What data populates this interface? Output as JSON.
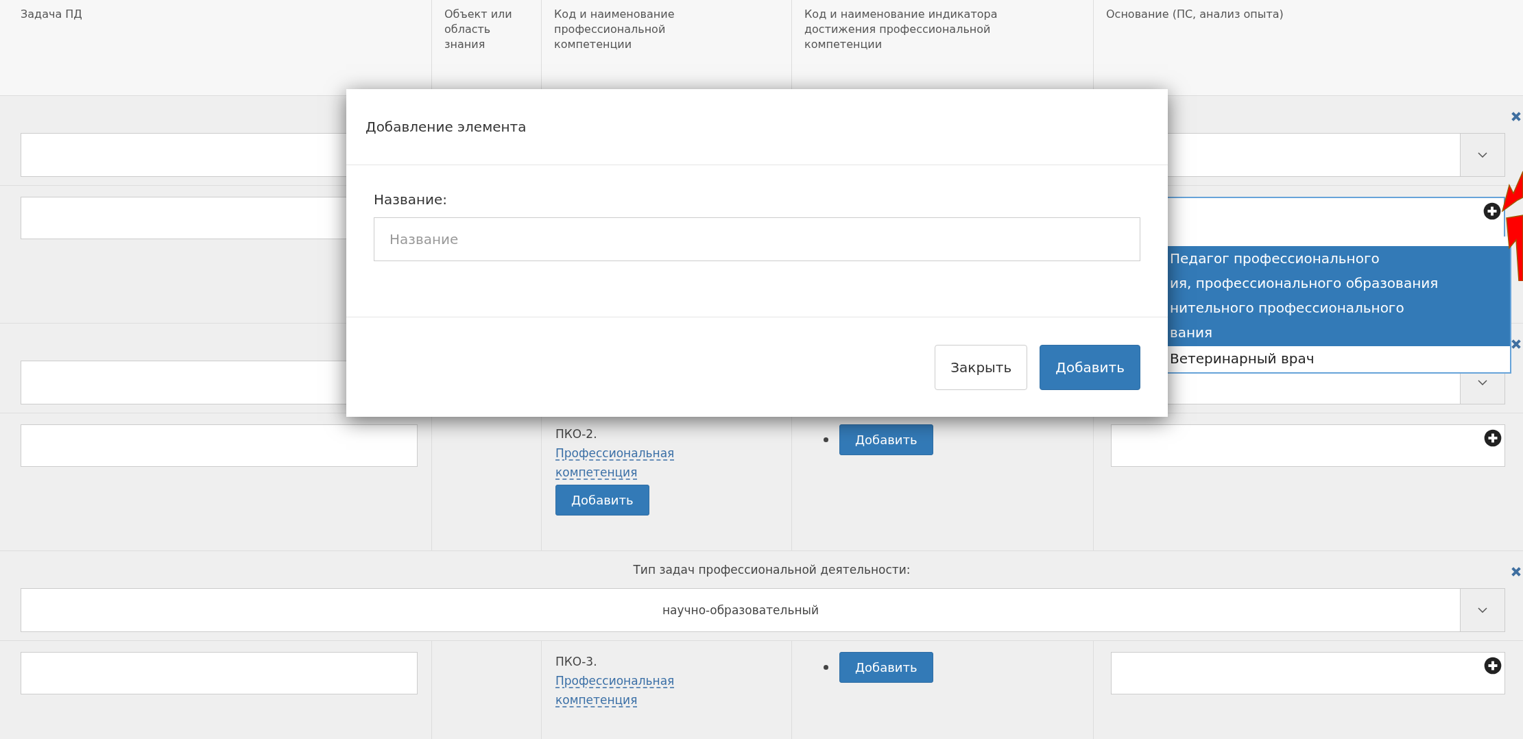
{
  "table": {
    "columns": [
      "Задача ПД",
      "Объект или область знания",
      "Код и наименование профессиональной компетенции",
      "Код и наименование индикатора достижения профессиональной компетенции",
      "Основание (ПС, анализ опыта)"
    ],
    "rows": [
      {
        "kind": "type"
      },
      {
        "kind": "task",
        "basis_focused": true
      },
      {
        "kind": "type"
      },
      {
        "kind": "task",
        "code": "ПКО-2.",
        "competence": "Профессиональная компетенция",
        "competence_button": "Добавить",
        "indicator_button": "Добавить",
        "basis_focused": false
      },
      {
        "kind": "type",
        "label": "Тип задач профессиональной деятельности:",
        "value": "научно-образовательный"
      },
      {
        "kind": "task",
        "code": "ПКО-3.",
        "competence": "Профессиональная компетенция",
        "indicator_button": "Добавить",
        "basis_focused": false
      }
    ]
  },
  "dropdown": {
    "options": [
      {
        "lines": [
          "Педагог профессионального",
          "ия, профессионального образования",
          "нительного профессионального",
          "вания"
        ],
        "selected": true
      },
      {
        "lines": [
          "Ветеринарный врач"
        ],
        "selected": false
      }
    ]
  },
  "modal": {
    "title": "Добавление элемента",
    "field_label": "Название:",
    "placeholder": "Название",
    "buttons": [
      {
        "label": "Закрыть",
        "kind": "default"
      },
      {
        "label": "Добавить",
        "kind": "primary"
      }
    ]
  }
}
